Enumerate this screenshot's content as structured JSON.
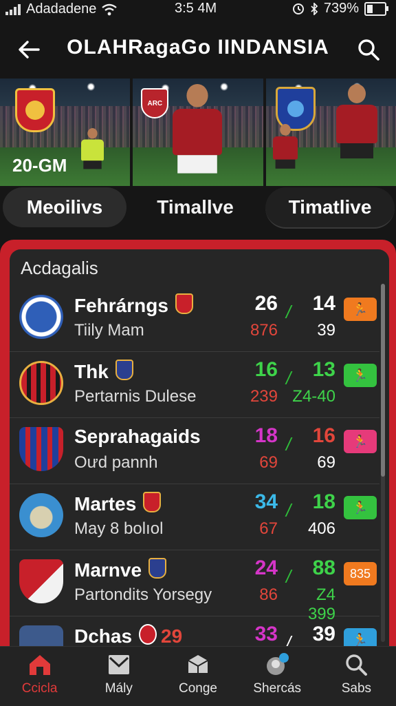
{
  "status_bar": {
    "carrier": "Adadadene",
    "time": "3:5 4M",
    "battery": "739%"
  },
  "header": {
    "title": "OLAHRagaGo IINDANSIA"
  },
  "banner": {
    "score_text": "20-GM",
    "crest_center_text": "ARC"
  },
  "tabs": [
    {
      "label": "Meoilivs",
      "active": true
    },
    {
      "label": "Timallve",
      "active": false
    },
    {
      "label": "Timatlive",
      "active": false
    }
  ],
  "section": {
    "title": "Acdagalis"
  },
  "matches": [
    {
      "name": "Fehrárngs",
      "sub": "Tiily Mam",
      "score1": "26",
      "score1_sub": "876",
      "score2": "14",
      "score2_sub": "39",
      "badge_text": "",
      "colors": {
        "s1": "#ffffff",
        "s1b": "#e2463b",
        "s2": "#ffffff",
        "s2b": "#ffffff",
        "badge": "#f07a1f"
      }
    },
    {
      "name": "Thk",
      "sub": "Pertarnis Dulese",
      "score1": "16",
      "score1_sub": "239",
      "score2": "13",
      "score2_sub": "Z4-40",
      "badge_text": "",
      "colors": {
        "s1": "#3ed34a",
        "s1b": "#e2463b",
        "s2": "#3ed34a",
        "s2b": "#3ed34a",
        "badge": "#34c23f"
      }
    },
    {
      "name": "Seprahagaids",
      "sub": "Oưd pannh",
      "score1": "18",
      "score1_sub": "69",
      "score2": "16",
      "score2_sub": "69",
      "badge_text": "",
      "colors": {
        "s1": "#d535c8",
        "s1b": "#e2463b",
        "s2": "#e2463b",
        "s2b": "#ffffff",
        "badge": "#e63a7a"
      }
    },
    {
      "name": "Martes",
      "sub": "May 8 bolıol",
      "score1": "34",
      "score1_sub": "67",
      "score2": "18",
      "score2_sub": "406",
      "badge_text": "",
      "colors": {
        "s1": "#3bb9e8",
        "s1b": "#e2463b",
        "s2": "#3ed34a",
        "s2b": "#ffffff",
        "badge": "#34c23f"
      }
    },
    {
      "name": "Marnve",
      "sub": "Partondits Yorsegy",
      "score1": "24",
      "score1_sub": "86",
      "score2": "88",
      "score2_sub": "Z4 399",
      "badge_text": "835",
      "colors": {
        "s1": "#d535c8",
        "s1b": "#e2463b",
        "s2": "#3ed34a",
        "s2b": "#3ed34a",
        "badge": "#f07a1f"
      }
    },
    {
      "name": "Dchas",
      "sub": "",
      "score1": "33",
      "score1_sub": "",
      "score2": "39",
      "score2_sub": "",
      "badge_text": "",
      "extra": "29",
      "colors": {
        "s1": "#d535c8",
        "s1b": "#e2463b",
        "s2": "#ffffff",
        "s2b": "#ffffff",
        "badge": "#2f9fdc"
      }
    }
  ],
  "bottom_nav": [
    {
      "label": "Ccicla",
      "icon": "home-icon",
      "active": true
    },
    {
      "label": "Mály",
      "icon": "inbox-icon",
      "active": false
    },
    {
      "label": "Conge",
      "icon": "box-icon",
      "active": false
    },
    {
      "label": "Shercás",
      "icon": "profile-icon",
      "active": false
    },
    {
      "label": "Sabs",
      "icon": "search-icon",
      "active": false
    }
  ],
  "accent_color": "#c8202a"
}
